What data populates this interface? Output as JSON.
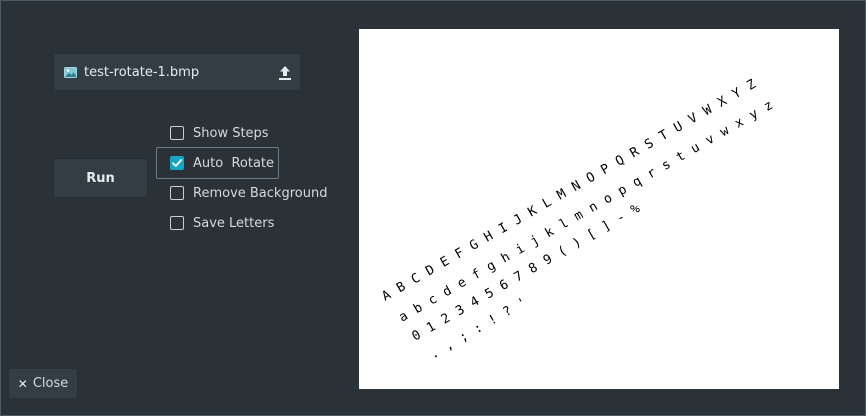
{
  "file_chooser": {
    "filename": "test-rotate-1.bmp"
  },
  "run_button": {
    "label": "Run"
  },
  "options": [
    {
      "label": "Show Steps",
      "checked": false
    },
    {
      "label": "Auto  Rotate",
      "checked": true
    },
    {
      "label": "Remove Background",
      "checked": false
    },
    {
      "label": "Save Letters",
      "checked": false
    }
  ],
  "close_button": {
    "label": "Close"
  },
  "preview": {
    "lines": [
      "A B C D E F G H I J K L M N O P Q R S T U V W X Y Z",
      "a b c d e f g h i j k l m n o p q r s t u v w x y z",
      "0 1 2 3 4 5 6 7 8 9 ( ) [ ] - %",
      ". , ; : ! ? ' "
    ]
  },
  "colors": {
    "window_bg": "#2a3238",
    "button_bg": "#323d44",
    "accent": "#15a4c2",
    "text": "#d3dade"
  }
}
